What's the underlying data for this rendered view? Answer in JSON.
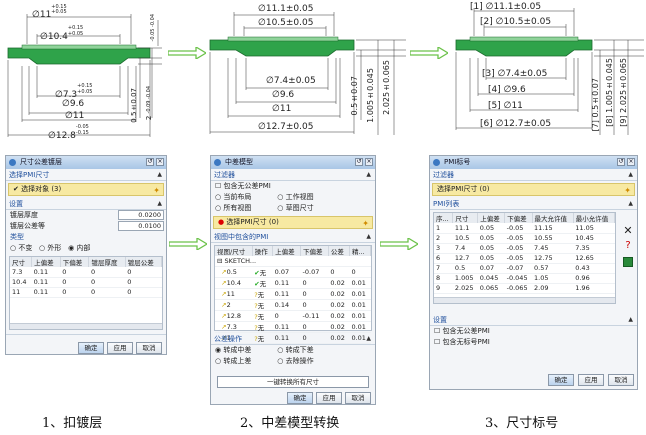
{
  "drawing1": {
    "top1": "∅11",
    "top1_tol_up": "+0.15",
    "top1_tol_dn": "+0.05",
    "top2": "∅10.4",
    "top2_tol_up": "+0.15",
    "top2_tol_dn": "+0.05",
    "right_tol_up": "-0.05",
    "right_tol_dn": "-0.04",
    "b1": "∅7.3",
    "b1_tol_up": "+0.15",
    "b1_tol_dn": "+0.05",
    "b2": "∅9.6",
    "b3": "∅11",
    "b4": "∅12.8",
    "b4_tol_up": "-0.05",
    "b4_tol_dn": "-0.15",
    "v1": "0.5±0.07",
    "v2": "2",
    "v2_tol_up": "-0.09",
    "v2_tol_dn": "-0.04"
  },
  "drawing2": {
    "d1": "∅11.1±0.05",
    "d2": "∅10.5±0.05",
    "d3": "∅7.4±0.05",
    "d4": "∅9.6",
    "d5": "∅11",
    "d6": "∅12.7±0.05",
    "v1": "0.5±0.07",
    "v2": "1.005±0.045",
    "v3": "2.025±0.065"
  },
  "drawing3": {
    "d1": "[1] ∅11.1±0.05",
    "d2": "[2] ∅10.5±0.05",
    "d3": "[3] ∅7.4±0.05",
    "d4": "[4] ∅9.6",
    "d5": "[5] ∅11",
    "d6": "[6] ∅12.7±0.05",
    "v1": "[7] 0.5±0.07",
    "v2": "[8] 1.005±0.045",
    "v3": "[9] 2.025±0.065"
  },
  "dialog1": {
    "title": "尺寸公差镀层",
    "sec_select": "选择PMI尺寸",
    "select_obj": "✔ 选择对象 (3)",
    "sec_settings": "设置",
    "plate_thk_label": "镀层厚度",
    "plate_thk_val": "0.0200",
    "plate_tol_label": "镀层公差等",
    "plate_tol_val": "0.0100",
    "type_label": "类型",
    "radio_none": "不变",
    "radio_outer": "外形",
    "radio_inner": "内部",
    "columns": [
      "尺寸",
      "上偏差",
      "下偏差",
      "镀层厚度",
      "镀层公差"
    ],
    "rows": [
      [
        "7.3",
        "0.11",
        "0",
        "0",
        "0"
      ],
      [
        "10.4",
        "0.11",
        "0",
        "0",
        "0"
      ],
      [
        "11",
        "0.11",
        "0",
        "0",
        "0"
      ]
    ],
    "ok": "确定",
    "apply": "应用",
    "cancel": "取消"
  },
  "dialog2": {
    "title": "中差模型",
    "sec_filter": "过滤器",
    "chk_nontol": "包含无公差PMI",
    "r_all": "当前布局",
    "r_work": "工作视图",
    "r_views": "所有视图",
    "r_sel": "草图尺寸",
    "select_pmi": "选择PMI尺寸 (0)",
    "sec_views": "视图中包含的PMI",
    "columns": [
      "视图/尺寸",
      "操作",
      "上偏差",
      "下偏差",
      "公差",
      "精..."
    ],
    "tree_root": "SKETCH...",
    "rows": [
      [
        "0.5",
        "无",
        "0.07",
        "-0.07",
        "0",
        "0"
      ],
      [
        "10.4",
        "无",
        "0.11",
        "0",
        "0.02",
        "0.01"
      ],
      [
        "11",
        "无",
        "0.11",
        "0",
        "0.02",
        "0.01"
      ],
      [
        "2",
        "无",
        "0.14",
        "0",
        "0.02",
        "0.01"
      ],
      [
        "12.8",
        "无",
        "0",
        "-0.11",
        "0.02",
        "0.01"
      ],
      [
        "7.3",
        "无",
        "0.11",
        "0",
        "0.02",
        "0.01"
      ],
      [
        "1",
        "无",
        "0.11",
        "0",
        "0.02",
        "0.01"
      ]
    ],
    "sec_ops": "公差操作",
    "op_mid": "转成中差",
    "op_low": "转成下差",
    "op_up": "转成上差",
    "op_del": "去除操作",
    "convert_btn": "一键转换所有尺寸",
    "ok": "确定",
    "apply": "应用",
    "cancel": "取消"
  },
  "dialog3": {
    "title": "PMI标号",
    "sec_filter": "过滤器",
    "select_pmi": "选择PMI尺寸 (0)",
    "sec_list": "PMI列表",
    "columns": [
      "序...",
      "尺寸",
      "上偏差",
      "下偏差",
      "最大允许值",
      "最小允许值"
    ],
    "rows": [
      [
        "1",
        "11.1",
        "0.05",
        "-0.05",
        "11.15",
        "11.05"
      ],
      [
        "2",
        "10.5",
        "0.05",
        "-0.05",
        "10.55",
        "10.45"
      ],
      [
        "3",
        "7.4",
        "0.05",
        "-0.05",
        "7.45",
        "7.35"
      ],
      [
        "6",
        "12.7",
        "0.05",
        "-0.05",
        "12.75",
        "12.65"
      ],
      [
        "7",
        "0.5",
        "0.07",
        "-0.07",
        "0.57",
        "0.43"
      ],
      [
        "8",
        "1.005",
        "0.045",
        "-0.045",
        "1.05",
        "0.96"
      ],
      [
        "9",
        "2.025",
        "0.065",
        "-0.065",
        "2.09",
        "1.96"
      ]
    ],
    "sec_settings": "设置",
    "chk_nontol": "包含无公差PMI",
    "chk_nolabel": "包含无标号PMI",
    "ok": "确定",
    "apply": "应用",
    "cancel": "取消"
  },
  "captions": {
    "c1": "1、扣镀层",
    "c2": "2、中差模型转换",
    "c3": "3、尺寸标号"
  }
}
